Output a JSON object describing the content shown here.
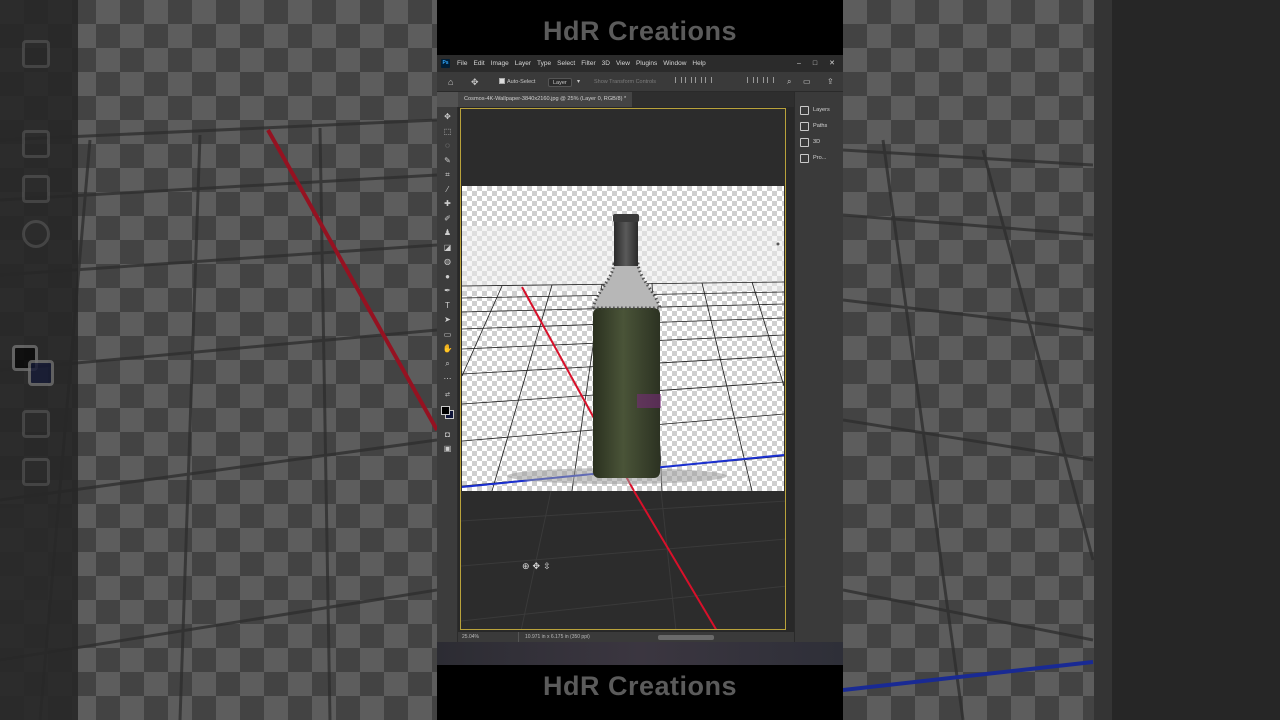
{
  "banner": {
    "top_text": "HdR Creations",
    "bottom_text": "HdR Creations"
  },
  "app": {
    "menu": [
      "File",
      "Edit",
      "Image",
      "Layer",
      "Type",
      "Select",
      "Filter",
      "3D",
      "View",
      "Plugins",
      "Window",
      "Help"
    ],
    "window_controls": [
      "–",
      "□",
      "✕"
    ]
  },
  "options_bar": {
    "auto_select_label": "Auto-Select",
    "layer_dropdown": "Layer",
    "show_transform_label": "Show Transform Controls"
  },
  "document": {
    "tab_title": "Cosmos-4K-Wallpaper-3840x2160.jpg @ 25% (Layer 0, RGB/8) *"
  },
  "panels": [
    {
      "label": "Layers",
      "icon": "layers-icon"
    },
    {
      "label": "Paths",
      "icon": "paths-icon"
    },
    {
      "label": "3D",
      "icon": "3d-cube-icon"
    },
    {
      "label": "Pro...",
      "icon": "properties-icon"
    }
  ],
  "status": {
    "zoom": "25.04%",
    "doc_size": "10.971 in x 6.175 in (350 ppi)"
  },
  "colors": {
    "foreground": "#000000",
    "background": "#10163a",
    "red_axis": "#d8102a",
    "blue_axis": "#1a2fd0",
    "bottle": "#3e4632"
  }
}
